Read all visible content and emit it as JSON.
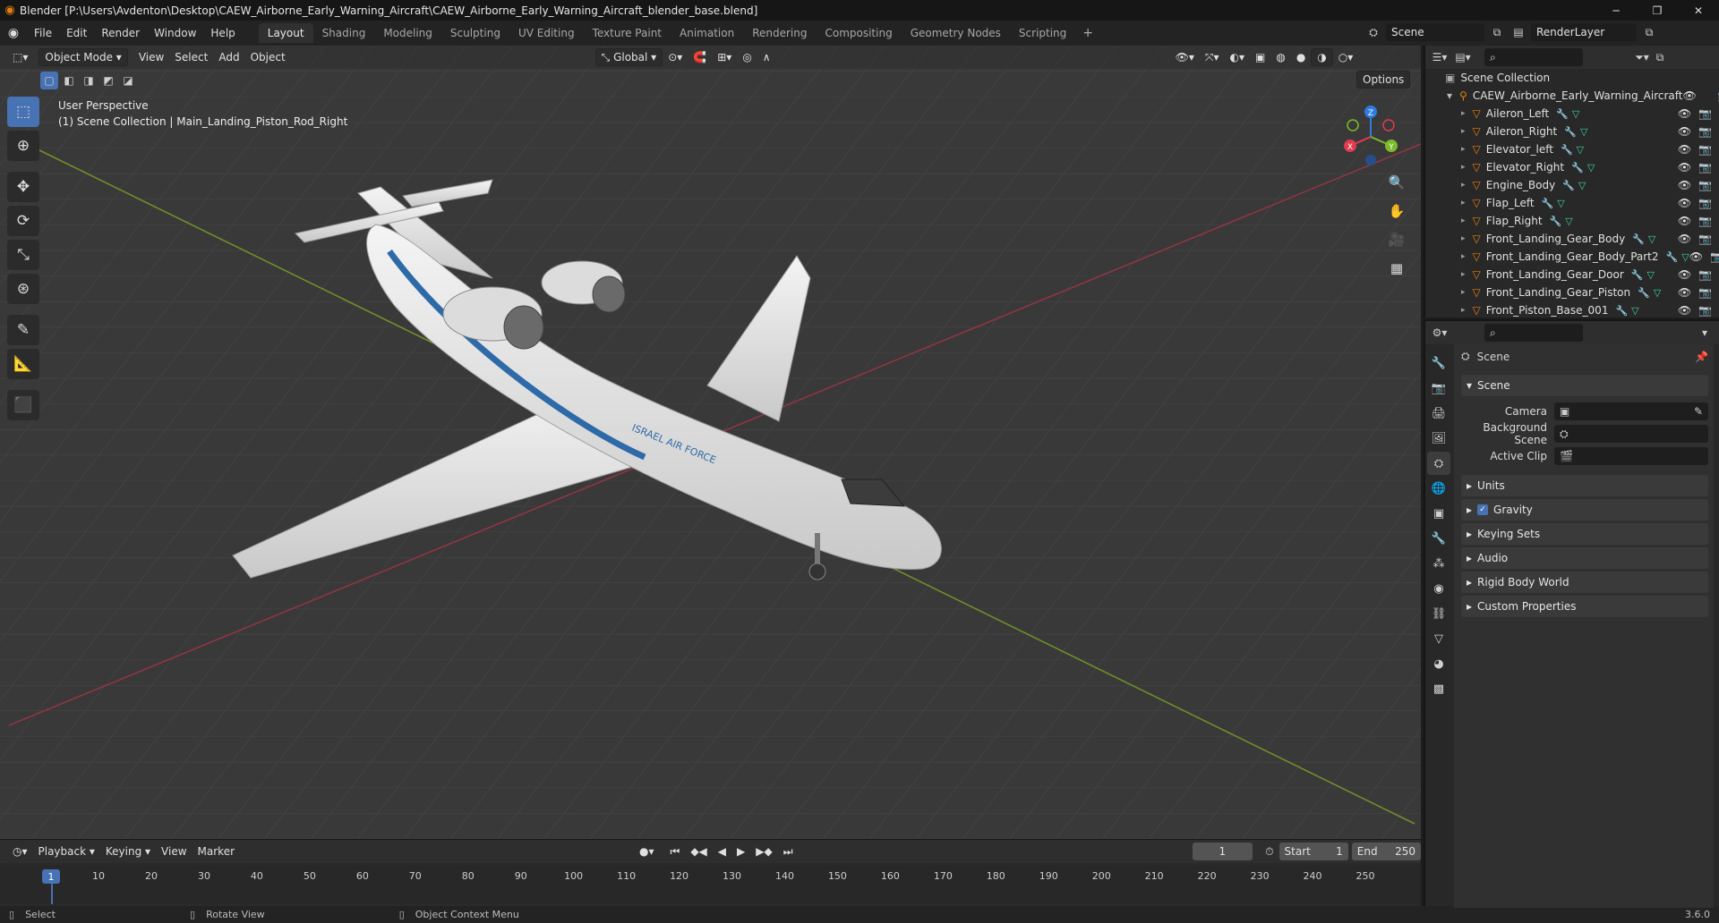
{
  "window": {
    "title": "Blender [P:\\Users\\Avdenton\\Desktop\\CAEW_Airborne_Early_Warning_Aircraft\\CAEW_Airborne_Early_Warning_Aircraft_blender_base.blend]",
    "controls": [
      "─",
      "❐",
      "✕"
    ]
  },
  "menu": [
    "File",
    "Edit",
    "Render",
    "Window",
    "Help"
  ],
  "workspaces": [
    "Layout",
    "Shading",
    "Modeling",
    "Sculpting",
    "UV Editing",
    "Texture Paint",
    "Animation",
    "Rendering",
    "Compositing",
    "Geometry Nodes",
    "Scripting"
  ],
  "active_workspace": "Layout",
  "scene_selector": {
    "scene": "Scene",
    "view_layer": "RenderLayer"
  },
  "viewport": {
    "mode": "Object Mode",
    "menus": [
      "View",
      "Select",
      "Add",
      "Object"
    ],
    "orientation": "Global",
    "options_label": "Options",
    "perspective": "User Perspective",
    "context": "(1) Scene Collection | Main_Landing_Piston_Rod_Right",
    "aircraft_text": "ISRAEL AIR FORCE",
    "gizmo_axes": [
      "Z",
      "Y",
      "X"
    ]
  },
  "timeline": {
    "menus": [
      "Playback",
      "Keying",
      "View",
      "Marker"
    ],
    "current_frame": "1",
    "start_label": "Start",
    "start": "1",
    "end_label": "End",
    "end": "250",
    "ruler": [
      "1",
      "10",
      "20",
      "30",
      "40",
      "50",
      "60",
      "70",
      "80",
      "90",
      "100",
      "110",
      "120",
      "130",
      "140",
      "150",
      "160",
      "170",
      "180",
      "190",
      "200",
      "210",
      "220",
      "230",
      "240",
      "250"
    ]
  },
  "status": {
    "select": "Select",
    "rotate": "Rotate View",
    "context_menu": "Object Context Menu",
    "version": "3.6.0"
  },
  "outliner": {
    "root": "Scene Collection",
    "collection": "CAEW_Airborne_Early_Warning_Aircraft",
    "items": [
      {
        "name": "Aileron_Left"
      },
      {
        "name": "Aileron_Right"
      },
      {
        "name": "Elevator_left"
      },
      {
        "name": "Elevator_Right"
      },
      {
        "name": "Engine_Body"
      },
      {
        "name": "Flap_Left"
      },
      {
        "name": "Flap_Right"
      },
      {
        "name": "Front_Landing_Gear_Body"
      },
      {
        "name": "Front_Landing_Gear_Body_Part2"
      },
      {
        "name": "Front_Landing_Gear_Door"
      },
      {
        "name": "Front_Landing_Gear_Piston"
      },
      {
        "name": "Front_Piston_Base_001"
      }
    ]
  },
  "properties": {
    "breadcrumb": "Scene",
    "scene_panel": "Scene",
    "camera_label": "Camera",
    "background_label": "Background Scene",
    "clip_label": "Active Clip",
    "panels": [
      "Units",
      "Gravity",
      "Keying Sets",
      "Audio",
      "Rigid Body World",
      "Custom Properties"
    ],
    "gravity_checked": true
  },
  "colors": {
    "accent": "#4772b3",
    "orange": "#e87d0d",
    "x_axis": "#e03a4f",
    "y_axis": "#7dbb2a",
    "z_axis": "#2f7ce0"
  }
}
